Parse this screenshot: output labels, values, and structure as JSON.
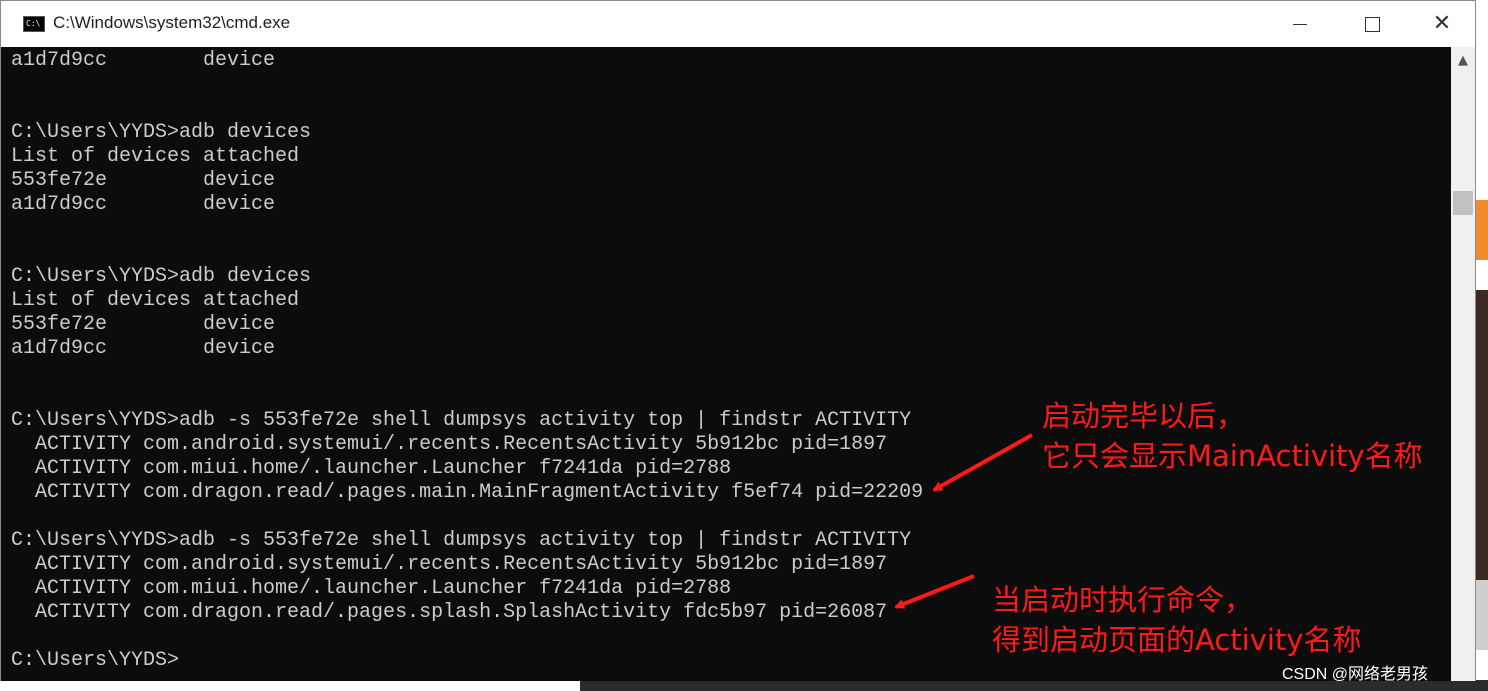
{
  "window": {
    "title": "C:\\Windows\\system32\\cmd.exe",
    "icon_name": "cmd-icon",
    "controls": [
      "minimize-icon",
      "maximize-icon",
      "close-icon"
    ]
  },
  "console": {
    "lines": [
      "a1d7d9cc        device",
      "",
      "",
      "C:\\Users\\YYDS>adb devices",
      "List of devices attached",
      "553fe72e        device",
      "a1d7d9cc        device",
      "",
      "",
      "C:\\Users\\YYDS>adb devices",
      "List of devices attached",
      "553fe72e        device",
      "a1d7d9cc        device",
      "",
      "",
      "C:\\Users\\YYDS>adb -s 553fe72e shell dumpsys activity top | findstr ACTIVITY",
      "  ACTIVITY com.android.systemui/.recents.RecentsActivity 5b912bc pid=1897",
      "  ACTIVITY com.miui.home/.launcher.Launcher f7241da pid=2788",
      "  ACTIVITY com.dragon.read/.pages.main.MainFragmentActivity f5ef74 pid=22209",
      "",
      "C:\\Users\\YYDS>adb -s 553fe72e shell dumpsys activity top | findstr ACTIVITY",
      "  ACTIVITY com.android.systemui/.recents.RecentsActivity 5b912bc pid=1897",
      "  ACTIVITY com.miui.home/.launcher.Launcher f7241da pid=2788",
      "  ACTIVITY com.dragon.read/.pages.splash.SplashActivity fdc5b97 pid=26087",
      "",
      "C:\\Users\\YYDS>"
    ]
  },
  "annotations": {
    "first": [
      "启动完毕以后，",
      "它只会显示MainActivity名称"
    ],
    "second": [
      "当启动时执行命令，",
      "得到启动页面的Activity名称"
    ],
    "color": "#ff1a1a"
  },
  "watermark": "CSDN @网络老男孩",
  "colors": {
    "console_bg": "#0c0c0c",
    "console_text": "#cccccc",
    "titlebar_bg": "#ffffff"
  }
}
